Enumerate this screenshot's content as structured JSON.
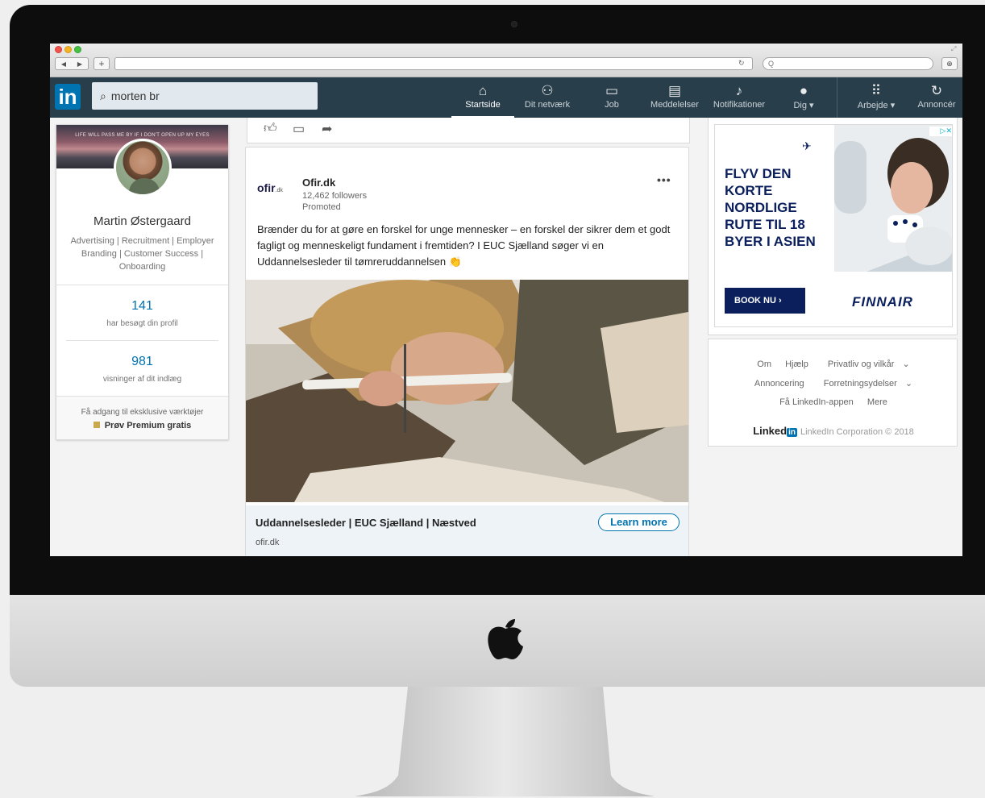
{
  "browser": {
    "search_placeholder": "Q"
  },
  "nav": {
    "logo": "in",
    "search_value": "morten br",
    "items": [
      {
        "label": "Startside"
      },
      {
        "label": "Dit netværk"
      },
      {
        "label": "Job"
      },
      {
        "label": "Meddelelser"
      },
      {
        "label": "Notifikationer"
      },
      {
        "label": "Dig"
      },
      {
        "label": "Arbejde"
      },
      {
        "label": "Annoncér"
      }
    ]
  },
  "profile": {
    "banner_text": "LIFE WILL PASS ME BY IF I DON'T OPEN UP MY EYES",
    "name": "Martin Østergaard",
    "headline": "Advertising | Recruitment | Employer Branding | Customer Success | Onboarding",
    "stat1_value": "141",
    "stat1_label": "har besøgt din profil",
    "stat2_value": "981",
    "stat2_label": "visninger af dit indlæg",
    "premium_text": "Få adgang til eksklusive værktøjer",
    "premium_cta": "Prøv Premium gratis"
  },
  "post": {
    "company_logo": "ofir",
    "company_logo_suffix": ".dk",
    "company_name": "Ofir.dk",
    "followers": "12,462 followers",
    "promoted": "Promoted",
    "more": "•••",
    "text": "Brænder du for at gøre en forskel for unge mennesker – en forskel der sikrer dem et godt fagligt og menneskeligt fundament i fremtiden? I EUC Sjælland søger vi en Uddannelsesleder til tømreruddannelsen 👏",
    "ad_title": "Uddannelsesleder | EUC Sjælland | Næstved",
    "ad_domain": "ofir.dk",
    "learn_more": "Learn more"
  },
  "ad": {
    "headline": "FLYV DEN KORTE NORDLIGE RUTE TIL 18 BYER I ASIEN",
    "book_now": "BOOK NU",
    "brand": "FINNAIR"
  },
  "footer": {
    "links_row1": [
      "Om",
      "Hjælp",
      "Privatliv og vilkår"
    ],
    "links_row2": [
      "Annoncering",
      "Forretningsydelser"
    ],
    "links_row3": [
      "Få LinkedIn-appen",
      "Mere"
    ],
    "brand_word": "Linked",
    "brand_in": "in",
    "copyright": "LinkedIn Corporation © 2018"
  }
}
